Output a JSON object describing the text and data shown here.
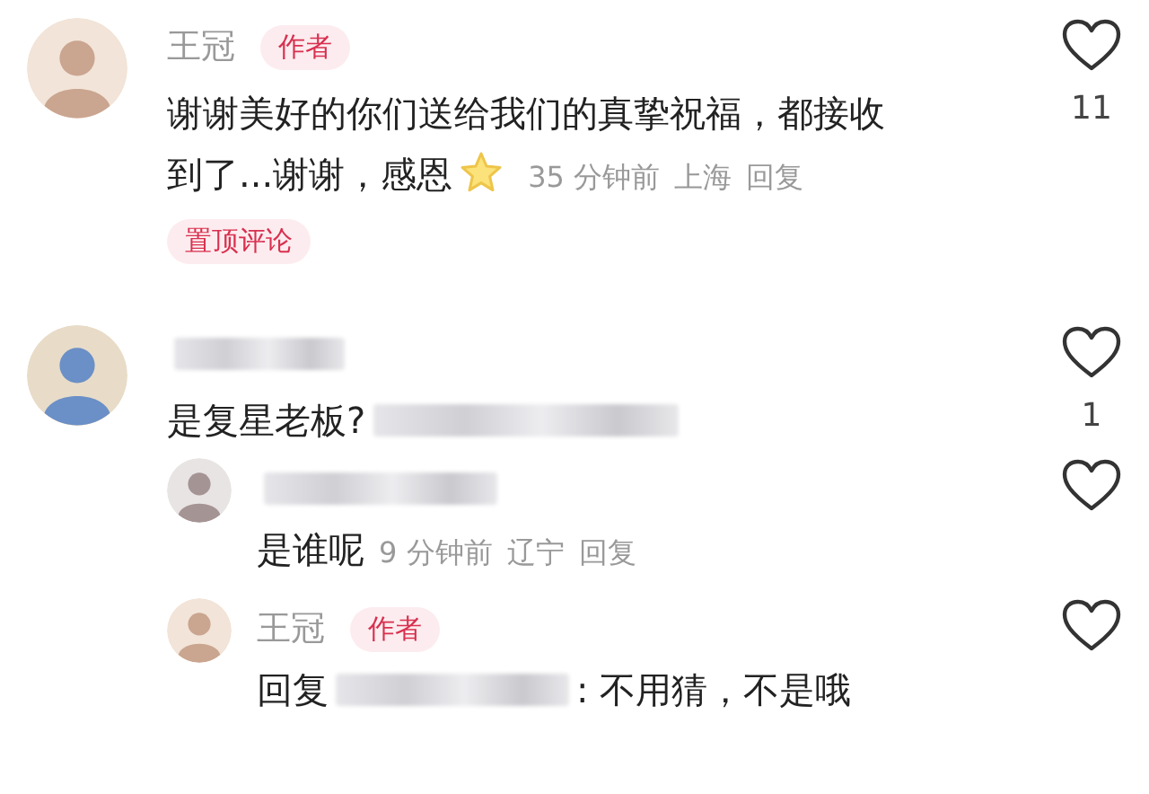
{
  "comments": [
    {
      "name": "王冠",
      "badge": "作者",
      "body": [
        {
          "kind": "text",
          "text": "谢谢美好的你们送给我们的真挚祝福，都接收"
        },
        {
          "kind": "text",
          "text": "到了...谢谢，感恩"
        },
        {
          "kind": "emoji"
        }
      ],
      "meta": [
        "35 分钟前",
        "上海",
        "回复"
      ],
      "likes": "11",
      "pinned": "置顶评论"
    },
    {
      "body": [
        {
          "kind": "text",
          "text": "是复星老板?"
        },
        {
          "kind": "blur"
        }
      ],
      "likes": "1",
      "replies": [
        {
          "body": [
            {
              "kind": "text",
              "text": "是谁呢"
            }
          ],
          "meta": [
            "9 分钟前",
            "辽宁",
            "回复"
          ]
        },
        {
          "name": "王冠",
          "badge": "作者",
          "body": [
            {
              "kind": "text",
              "text": "回复"
            },
            {
              "kind": "blur"
            },
            {
              "kind": "text",
              "text": ": 不用猜，不是哦"
            }
          ]
        }
      ]
    }
  ]
}
